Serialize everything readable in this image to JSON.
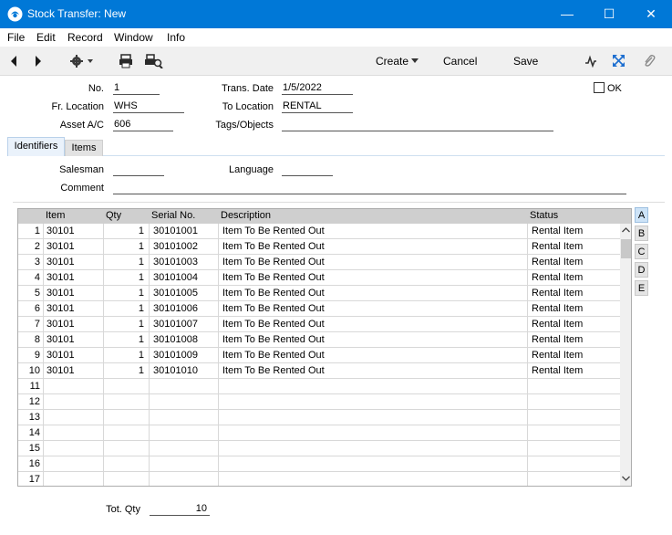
{
  "window": {
    "title": "Stock Transfer: New"
  },
  "menu": [
    "File",
    "Edit",
    "Record",
    "Window",
    "Info"
  ],
  "toolbar": {
    "create": "Create",
    "cancel": "Cancel",
    "save": "Save"
  },
  "header": {
    "no_label": "No.",
    "no_value": "1",
    "trans_date_label": "Trans. Date",
    "trans_date_value": "1/5/2022",
    "ok_label": "OK",
    "fr_location_label": "Fr. Location",
    "fr_location_value": "WHS",
    "to_location_label": "To Location",
    "to_location_value": "RENTAL",
    "asset_ac_label": "Asset A/C",
    "asset_ac_value": "606",
    "tags_label": "Tags/Objects",
    "tags_value": ""
  },
  "tabs": [
    "Identifiers",
    "Items"
  ],
  "identifiers": {
    "salesman_label": "Salesman",
    "salesman_value": "",
    "language_label": "Language",
    "language_value": "",
    "comment_label": "Comment",
    "comment_value": ""
  },
  "grid": {
    "columns": [
      "Item",
      "Qty",
      "Serial No.",
      "Description",
      "Status"
    ],
    "rows": [
      {
        "n": "1",
        "item": "30101",
        "qty": "1",
        "serial": "30101001",
        "desc": "Item To Be Rented Out",
        "status": "Rental Item"
      },
      {
        "n": "2",
        "item": "30101",
        "qty": "1",
        "serial": "30101002",
        "desc": "Item To Be Rented Out",
        "status": "Rental Item"
      },
      {
        "n": "3",
        "item": "30101",
        "qty": "1",
        "serial": "30101003",
        "desc": "Item To Be Rented Out",
        "status": "Rental Item"
      },
      {
        "n": "4",
        "item": "30101",
        "qty": "1",
        "serial": "30101004",
        "desc": "Item To Be Rented Out",
        "status": "Rental Item"
      },
      {
        "n": "5",
        "item": "30101",
        "qty": "1",
        "serial": "30101005",
        "desc": "Item To Be Rented Out",
        "status": "Rental Item"
      },
      {
        "n": "6",
        "item": "30101",
        "qty": "1",
        "serial": "30101006",
        "desc": "Item To Be Rented Out",
        "status": "Rental Item"
      },
      {
        "n": "7",
        "item": "30101",
        "qty": "1",
        "serial": "30101007",
        "desc": "Item To Be Rented Out",
        "status": "Rental Item"
      },
      {
        "n": "8",
        "item": "30101",
        "qty": "1",
        "serial": "30101008",
        "desc": "Item To Be Rented Out",
        "status": "Rental Item"
      },
      {
        "n": "9",
        "item": "30101",
        "qty": "1",
        "serial": "30101009",
        "desc": "Item To Be Rented Out",
        "status": "Rental Item"
      },
      {
        "n": "10",
        "item": "30101",
        "qty": "1",
        "serial": "30101010",
        "desc": "Item To Be Rented Out",
        "status": "Rental Item"
      },
      {
        "n": "11",
        "item": "",
        "qty": "",
        "serial": "",
        "desc": "",
        "status": ""
      },
      {
        "n": "12",
        "item": "",
        "qty": "",
        "serial": "",
        "desc": "",
        "status": ""
      },
      {
        "n": "13",
        "item": "",
        "qty": "",
        "serial": "",
        "desc": "",
        "status": ""
      },
      {
        "n": "14",
        "item": "",
        "qty": "",
        "serial": "",
        "desc": "",
        "status": ""
      },
      {
        "n": "15",
        "item": "",
        "qty": "",
        "serial": "",
        "desc": "",
        "status": ""
      },
      {
        "n": "16",
        "item": "",
        "qty": "",
        "serial": "",
        "desc": "",
        "status": ""
      },
      {
        "n": "17",
        "item": "",
        "qty": "",
        "serial": "",
        "desc": "",
        "status": ""
      }
    ]
  },
  "side_tabs": [
    "A",
    "B",
    "C",
    "D",
    "E"
  ],
  "footer": {
    "tot_qty_label": "Tot. Qty",
    "tot_qty_value": "10"
  }
}
